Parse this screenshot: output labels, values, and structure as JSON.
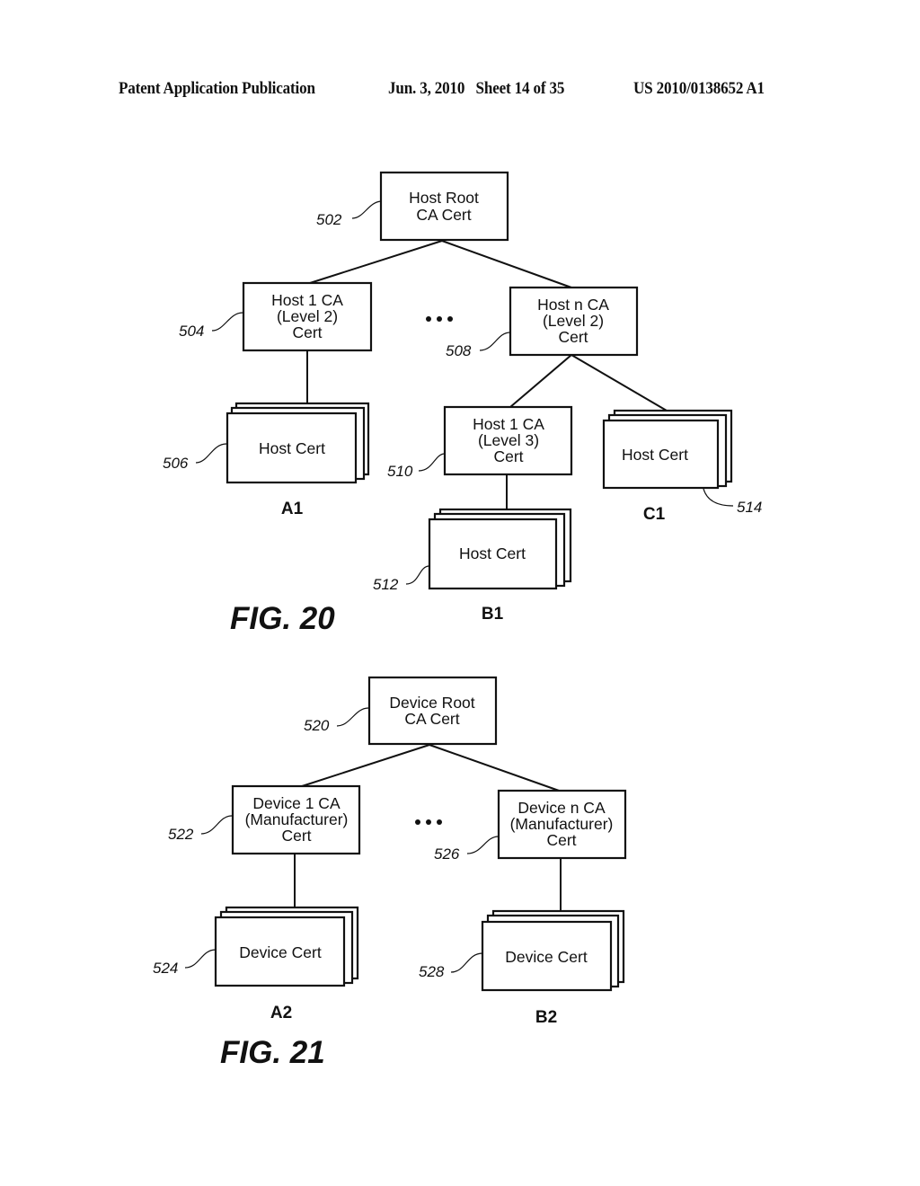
{
  "header": {
    "publication": "Patent Application Publication",
    "date_sheet": "Jun. 3, 2010   Sheet 14 of 35",
    "number": "US 2010/0138652 A1"
  },
  "fig20": {
    "caption": "FIG. 20",
    "ellipsis": "•••",
    "nodes": {
      "host_root": {
        "lines": [
          "Host Root",
          "CA Cert"
        ],
        "ref": "502"
      },
      "host1_ca": {
        "lines": [
          "Host 1 CA",
          "(Level 2)",
          "Cert"
        ],
        "ref": "504"
      },
      "hostn_ca": {
        "lines": [
          "Host n CA",
          "(Level 2)",
          "Cert"
        ],
        "ref": "508"
      },
      "host_cert_a1": {
        "lines": [
          "Host Cert"
        ],
        "ref": "506",
        "group": "A1"
      },
      "host1_ca_l3": {
        "lines": [
          "Host 1 CA",
          "(Level 3)",
          "Cert"
        ],
        "ref": "510"
      },
      "host_cert_b1": {
        "lines": [
          "Host Cert"
        ],
        "ref": "512",
        "group": "B1"
      },
      "host_cert_c1": {
        "lines": [
          "Host Cert"
        ],
        "ref": "514",
        "group": "C1"
      }
    }
  },
  "fig21": {
    "caption": "FIG. 21",
    "ellipsis": "•••",
    "nodes": {
      "device_root": {
        "lines": [
          "Device Root",
          "CA Cert"
        ],
        "ref": "520"
      },
      "device1_ca": {
        "lines": [
          "Device 1 CA",
          "(Manufacturer)",
          "Cert"
        ],
        "ref": "522"
      },
      "devicen_ca": {
        "lines": [
          "Device n CA",
          "(Manufacturer)",
          "Cert"
        ],
        "ref": "526"
      },
      "device_cert_a2": {
        "lines": [
          "Device Cert"
        ],
        "ref": "524",
        "group": "A2"
      },
      "device_cert_b2": {
        "lines": [
          "Device Cert"
        ],
        "ref": "528",
        "group": "B2"
      }
    }
  }
}
